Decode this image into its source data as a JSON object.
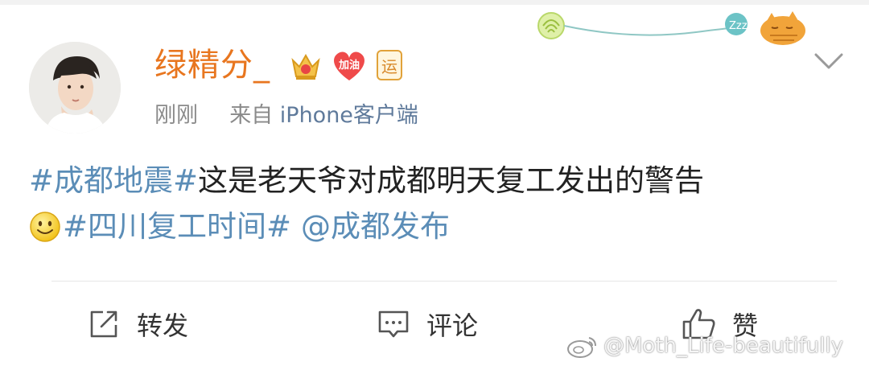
{
  "post": {
    "author_name": "绿精分_",
    "badges": {
      "heart_text": "加油",
      "yun_text": "运"
    },
    "time": "刚刚",
    "source_prefix": "来自",
    "source_client": "iPhone客户端",
    "content": {
      "hashtag1": "#成都地震#",
      "text1": "这是老天爷对成都明天复工发出的警告",
      "hashtag2": "#四川复工时间#",
      "mention": "@成都发布"
    }
  },
  "actions": {
    "repost_label": "转发",
    "comment_label": "评论",
    "like_label": "赞"
  },
  "watermark": "@Moth_Life-beautifully",
  "icons": {
    "avatar": "avatar-portrait",
    "crown": "crown-badge-icon",
    "heart": "heart-badge-icon",
    "yun": "yun-badge-icon",
    "chevron": "chevron-down-icon",
    "smile": "smile-emoji-icon",
    "repost": "repost-icon",
    "comment": "comment-icon",
    "like": "thumbs-up-icon",
    "weibo": "weibo-logo-icon"
  },
  "colors": {
    "username": "#e8761f",
    "link": "#5b8db7",
    "meta": "#8a8a8a"
  }
}
